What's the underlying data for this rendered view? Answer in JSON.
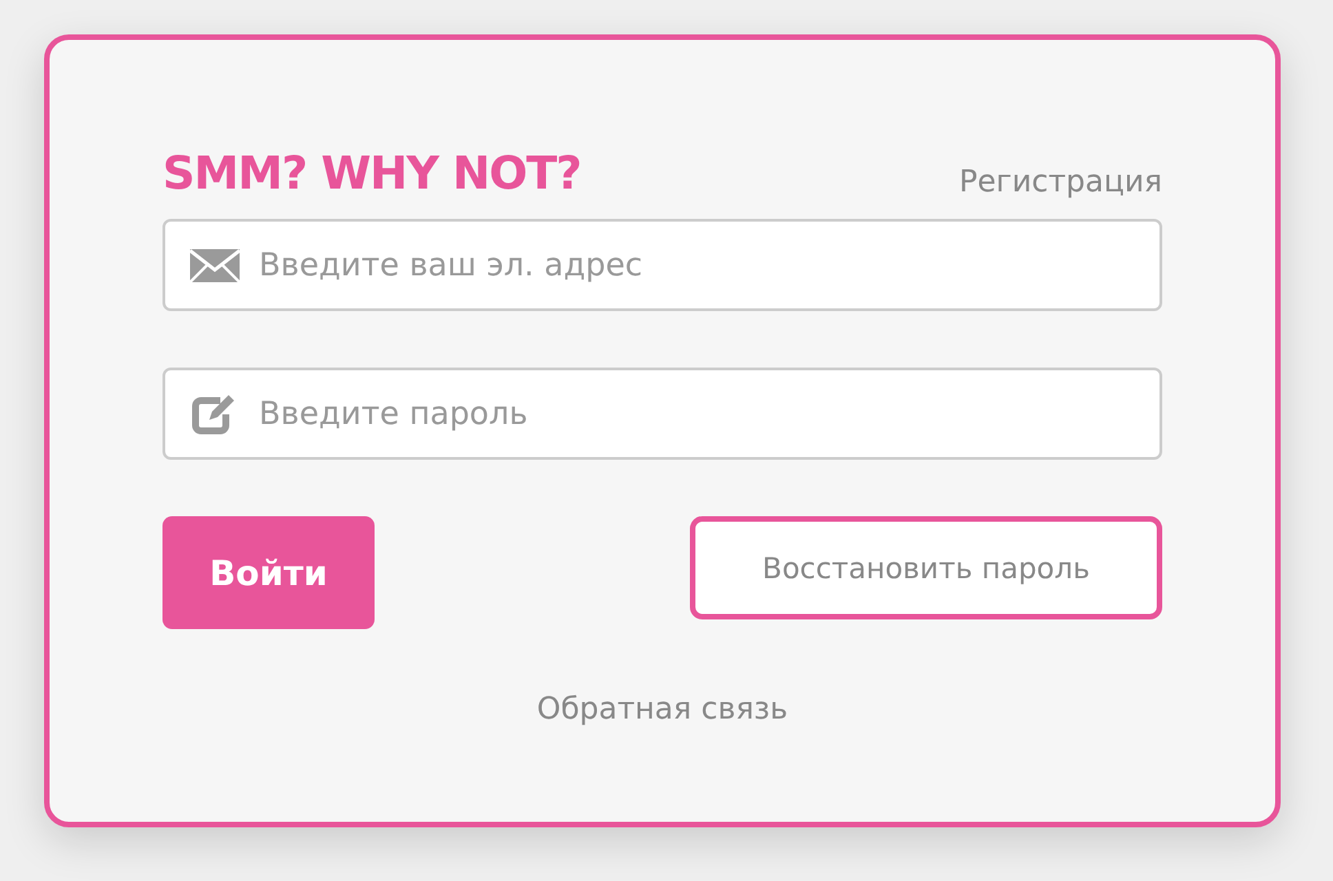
{
  "title": "SMM? WHY NOT?",
  "register_link": "Регистрация",
  "email_field": {
    "placeholder": "Введите ваш эл. адрес"
  },
  "password_field": {
    "placeholder": "Введите пароль"
  },
  "login_button": "Войти",
  "restore_button": "Восстановить пароль",
  "feedback_link": "Обратная связь"
}
